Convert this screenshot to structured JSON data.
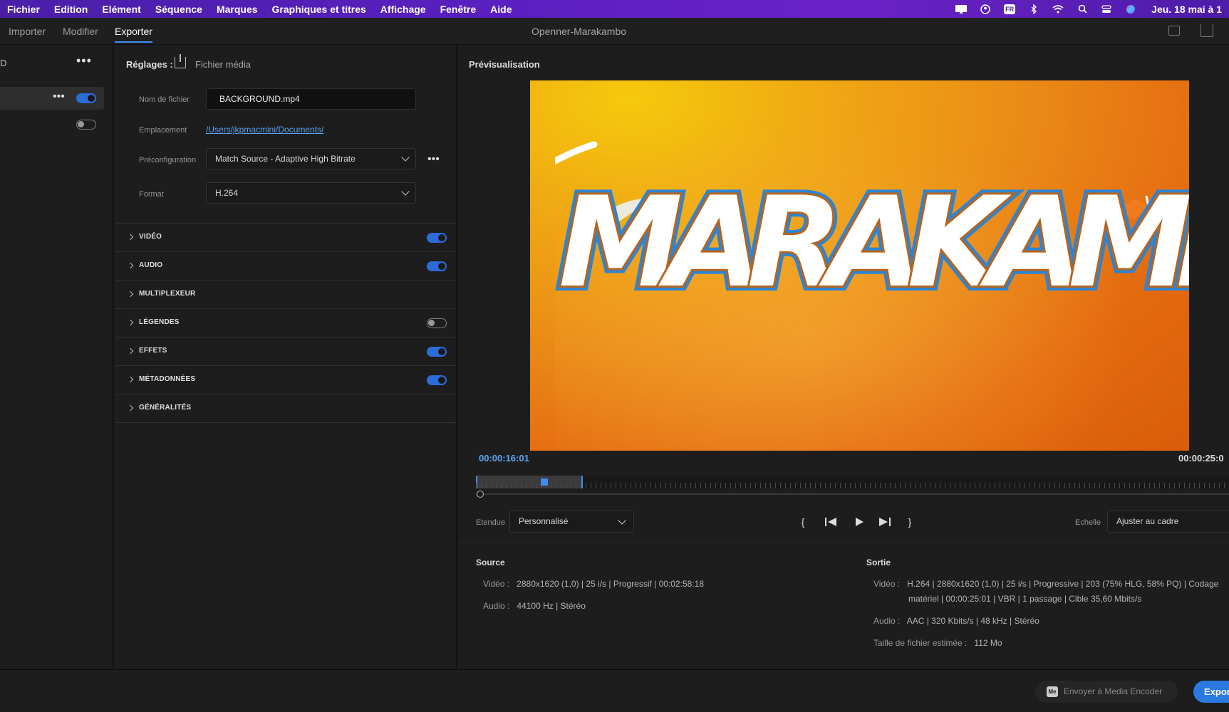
{
  "menubar": {
    "items": [
      "Fichier",
      "Edition",
      "Elément",
      "Séquence",
      "Marques",
      "Graphiques et titres",
      "Affichage",
      "Fenêtre",
      "Aide"
    ],
    "input_badge": "FR",
    "clock": "Jeu. 18 mai à 1"
  },
  "app": {
    "tabs": [
      "Importer",
      "Modifier",
      "Exporter"
    ],
    "active_tab": "Exporter",
    "document_title": "Openner-Marakambo"
  },
  "queue": {
    "label": "D"
  },
  "settings": {
    "title": "Réglages :",
    "media_label": "Fichier média",
    "filename_label": "Nom de fichier",
    "filename_value": "BACKGROUND.mp4",
    "location_label": "Emplacement",
    "location_value": "/Users/jkpmacmini/Documents/",
    "preset_label": "Préconfiguration",
    "preset_value": "Match Source - Adaptive High Bitrate",
    "format_label": "Format",
    "format_value": "H.264",
    "sections": [
      {
        "label": "VIDÉO",
        "enabled": true
      },
      {
        "label": "AUDIO",
        "enabled": true
      },
      {
        "label": "MULTIPLEXEUR",
        "enabled": null
      },
      {
        "label": "LÉGENDES",
        "enabled": false
      },
      {
        "label": "EFFETS",
        "enabled": true
      },
      {
        "label": "MÉTADONNÉES",
        "enabled": true
      },
      {
        "label": "GÉNÉRALITÉS",
        "enabled": null
      }
    ]
  },
  "preview": {
    "title": "Prévisualisation",
    "logo_text": "MARAKAMB",
    "timecode_current": "00:00:16:01",
    "timecode_end": "00:00:25:0",
    "playhead_fraction": 0.64,
    "range_label": "Etendue",
    "range_value": "Personnalisé",
    "scale_label": "Echelle",
    "scale_value": "Ajuster au cadre"
  },
  "info": {
    "source_title": "Source",
    "source_video_key": "Vidéo :",
    "source_video_value": "2880x1620 (1,0)  |  25 i/s  |  Progressif  |  00:02:58:18",
    "source_audio_key": "Audio :",
    "source_audio_value": "44100 Hz  |  Stéréo",
    "output_title": "Sortie",
    "output_video_key": "Vidéo :",
    "output_video_line1": "H.264  |  2880x1620 (1,0)  |  25 i/s  |  Progressive  |  203 (75% HLG, 58% PQ)  |  Codage",
    "output_video_line2": "matériel  |  00:00:25:01  |  VBR  |  1 passage  |  Cible 35,60  Mbits/s",
    "output_audio_key": "Audio :",
    "output_audio_value": "AAC  |  320  Kbits/s  |  48  kHz  |  Stéréo",
    "filesize_key": "Taille de fichier estimée :",
    "filesize_value": "112 Mo"
  },
  "footer": {
    "media_encoder_badge": "Me",
    "media_encoder_label": "Envoyer à Media Encoder",
    "export_label": "Export"
  },
  "colors": {
    "accent": "#3e8cf0",
    "menubar": "#5a1fc0",
    "link": "#5aa0f2"
  }
}
